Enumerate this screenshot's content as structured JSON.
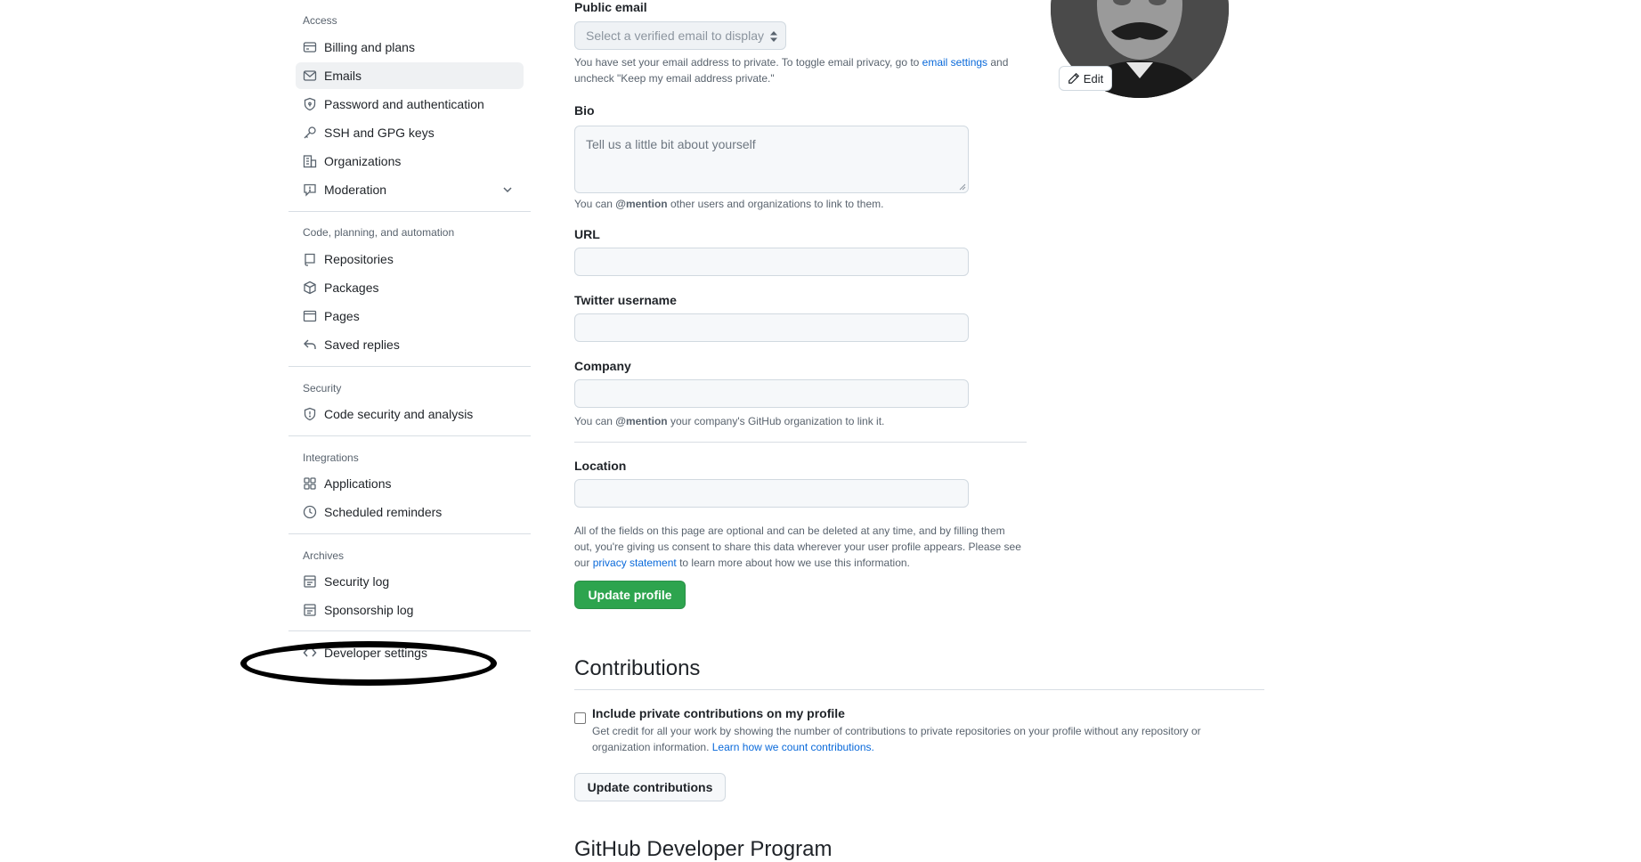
{
  "sidebar": {
    "access_heading": "Access",
    "access_items": [
      {
        "label": "Billing and plans",
        "icon": "credit-card-icon"
      },
      {
        "label": "Emails",
        "icon": "mail-icon",
        "active": true
      },
      {
        "label": "Password and authentication",
        "icon": "shield-lock-icon"
      },
      {
        "label": "SSH and GPG keys",
        "icon": "key-icon"
      },
      {
        "label": "Organizations",
        "icon": "organization-icon"
      },
      {
        "label": "Moderation",
        "icon": "report-icon",
        "expandable": true
      }
    ],
    "code_heading": "Code, planning, and automation",
    "code_items": [
      {
        "label": "Repositories",
        "icon": "repo-icon"
      },
      {
        "label": "Packages",
        "icon": "package-icon"
      },
      {
        "label": "Pages",
        "icon": "browser-icon"
      },
      {
        "label": "Saved replies",
        "icon": "reply-icon"
      }
    ],
    "security_heading": "Security",
    "security_items": [
      {
        "label": "Code security and analysis",
        "icon": "shield-icon"
      }
    ],
    "integrations_heading": "Integrations",
    "integrations_items": [
      {
        "label": "Applications",
        "icon": "apps-icon"
      },
      {
        "label": "Scheduled reminders",
        "icon": "clock-icon"
      }
    ],
    "archives_heading": "Archives",
    "archives_items": [
      {
        "label": "Security log",
        "icon": "log-icon"
      },
      {
        "label": "Sponsorship log",
        "icon": "log-icon"
      }
    ],
    "developer_settings": {
      "label": "Developer settings",
      "icon": "code-icon"
    }
  },
  "profile_form": {
    "public_email": {
      "label": "Public email",
      "select_value": "Select a verified email to display",
      "help_prefix": "You have set your email address to private. To toggle email privacy, go to ",
      "help_link": "email settings",
      "help_suffix": " and",
      "help_line2": "uncheck \"Keep my email address private.\""
    },
    "bio": {
      "label": "Bio",
      "placeholder": "Tell us a little bit about yourself",
      "help_prefix": "You can ",
      "help_bold": "@mention",
      "help_suffix": " other users and organizations to link to them."
    },
    "url": {
      "label": "URL"
    },
    "twitter": {
      "label": "Twitter username"
    },
    "company": {
      "label": "Company",
      "help_prefix": "You can ",
      "help_bold": "@mention",
      "help_suffix": " your company's GitHub organization to link it."
    },
    "location": {
      "label": "Location"
    },
    "disclaimer": {
      "line1": "All of the fields on this page are optional and can be deleted at any time, and by filling them",
      "line2": "out, you're giving us consent to share this data wherever your user profile appears. Please see",
      "line3_prefix": "our ",
      "line3_link": "privacy statement",
      "line3_suffix": " to learn more about how we use this information."
    },
    "update_button": "Update profile"
  },
  "contributions": {
    "heading": "Contributions",
    "checkbox_label": "Include private contributions on my profile",
    "help_line1": "Get credit for all your work by showing the number of contributions to private repositories on your profile without any repository or",
    "help_line2_prefix": "organization information. ",
    "help_line2_link": "Learn how we count contributions.",
    "update_button": "Update contributions"
  },
  "next_heading": "GitHub Developer Program",
  "avatar": {
    "edit_label": "Edit"
  },
  "colors": {
    "primary_button": "#2da44e",
    "link": "#0969da",
    "annotation": "#000000"
  }
}
